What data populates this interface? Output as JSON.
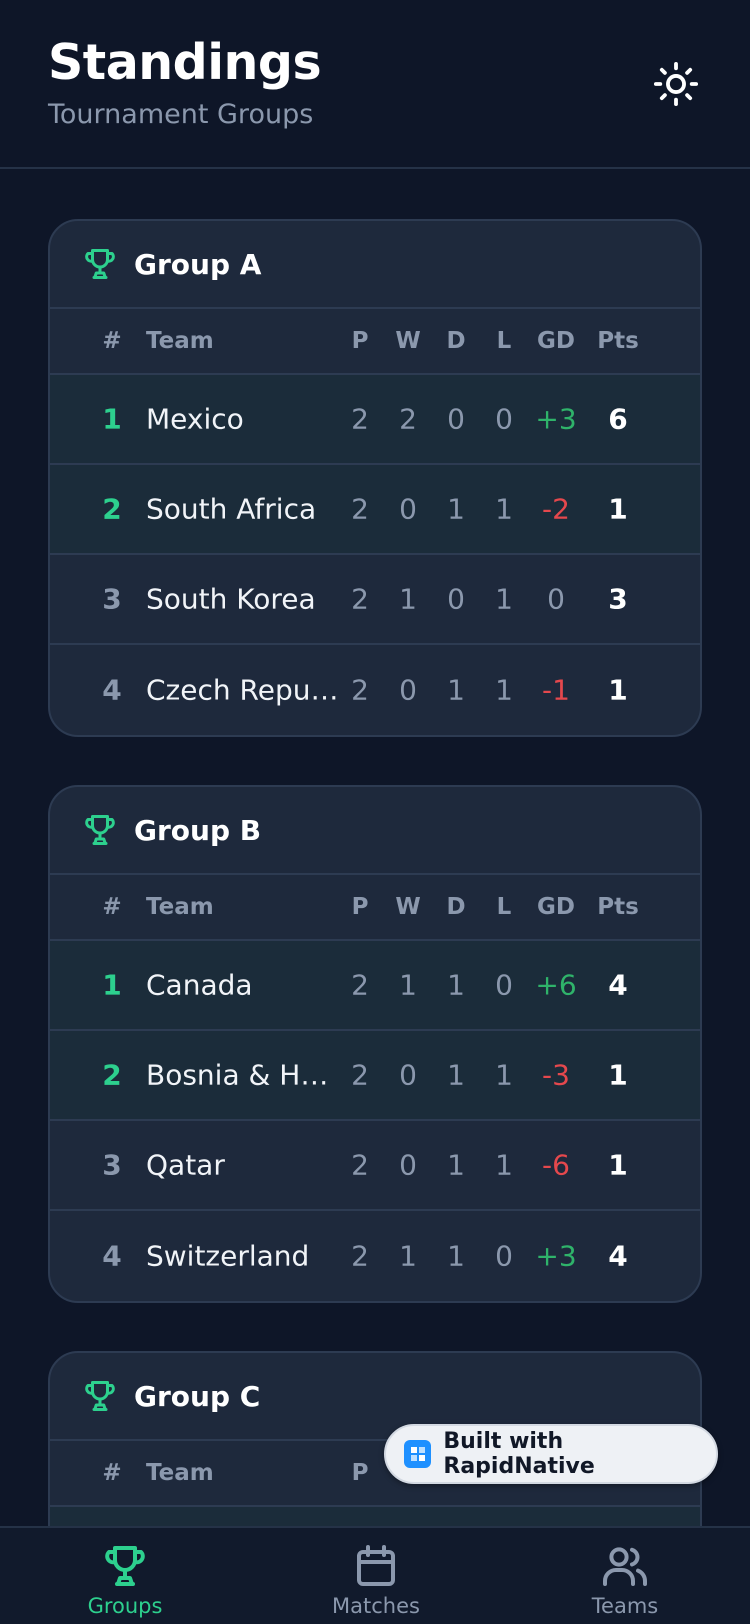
{
  "header": {
    "title": "Standings",
    "subtitle": "Tournament Groups",
    "theme_icon": "sun-icon"
  },
  "colors": {
    "background": "#0e1628",
    "card": "#1e293c",
    "accent": "#2dd08e",
    "positive": "#2fb36a",
    "negative": "#e5484d"
  },
  "table_headers": {
    "pos": "#",
    "team": "Team",
    "p": "P",
    "w": "W",
    "d": "D",
    "l": "L",
    "gd": "GD",
    "pts": "Pts"
  },
  "groups": [
    {
      "name": "Group A",
      "rows": [
        {
          "pos": "1",
          "team": "Mexico",
          "p": "2",
          "w": "2",
          "d": "0",
          "l": "0",
          "gd": "+3",
          "pts": "6"
        },
        {
          "pos": "2",
          "team": "South Africa",
          "p": "2",
          "w": "0",
          "d": "1",
          "l": "1",
          "gd": "-2",
          "pts": "1"
        },
        {
          "pos": "3",
          "team": "South Korea",
          "p": "2",
          "w": "1",
          "d": "0",
          "l": "1",
          "gd": "0",
          "pts": "3"
        },
        {
          "pos": "4",
          "team": "Czech Republic",
          "p": "2",
          "w": "0",
          "d": "1",
          "l": "1",
          "gd": "-1",
          "pts": "1"
        }
      ]
    },
    {
      "name": "Group B",
      "rows": [
        {
          "pos": "1",
          "team": "Canada",
          "p": "2",
          "w": "1",
          "d": "1",
          "l": "0",
          "gd": "+6",
          "pts": "4"
        },
        {
          "pos": "2",
          "team": "Bosnia & Her...",
          "p": "2",
          "w": "0",
          "d": "1",
          "l": "1",
          "gd": "-3",
          "pts": "1"
        },
        {
          "pos": "3",
          "team": "Qatar",
          "p": "2",
          "w": "0",
          "d": "1",
          "l": "1",
          "gd": "-6",
          "pts": "1"
        },
        {
          "pos": "4",
          "team": "Switzerland",
          "p": "2",
          "w": "1",
          "d": "1",
          "l": "0",
          "gd": "+3",
          "pts": "4"
        }
      ]
    },
    {
      "name": "Group C",
      "rows": []
    }
  ],
  "badge": {
    "text": "Built with RapidNative"
  },
  "nav": {
    "items": [
      {
        "label": "Groups",
        "icon": "trophy-icon",
        "active": true
      },
      {
        "label": "Matches",
        "icon": "calendar-icon",
        "active": false
      },
      {
        "label": "Teams",
        "icon": "users-icon",
        "active": false
      }
    ]
  }
}
